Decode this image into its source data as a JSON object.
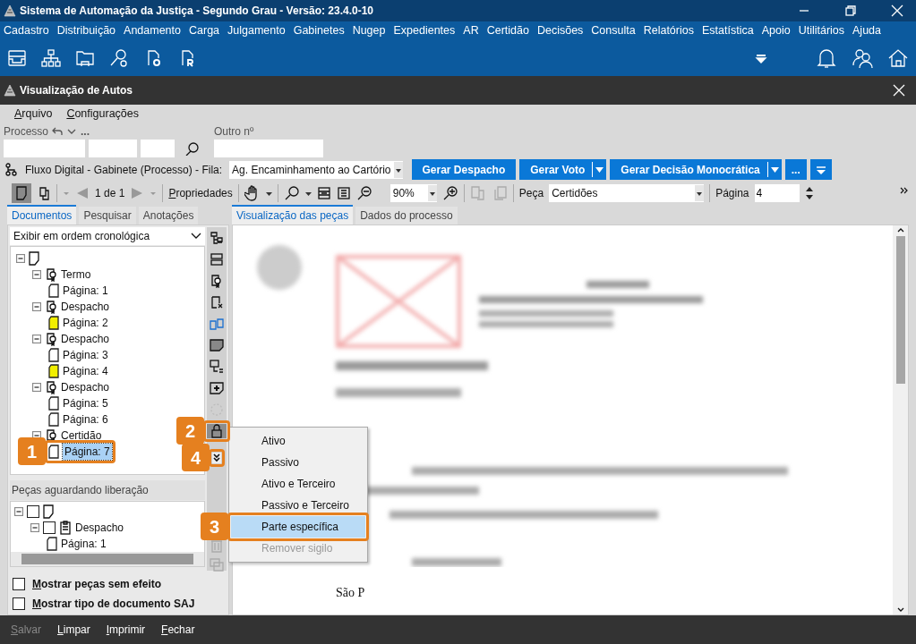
{
  "window": {
    "title": "Sistema de Automação da Justiça - Segundo Grau - Versão: 23.4.0-10"
  },
  "menu": [
    "Cadastro",
    "Distribuição",
    "Andamento",
    "Carga",
    "Julgamento",
    "Gabinetes",
    "Nugep",
    "Expedientes",
    "AR",
    "Certidão",
    "Decisões",
    "Consulta",
    "Relatórios",
    "Estatística",
    "Apoio",
    "Utilitários",
    "Ajuda"
  ],
  "inner_window": {
    "title": "Visualização de Autos"
  },
  "inner_menu": [
    "Arquivo",
    "Configurações"
  ],
  "process": {
    "label": "Processo",
    "more": "...",
    "other_label": "Outro nº"
  },
  "flow": {
    "text": "Fluxo Digital - Gabinete (Processo) - Fila:",
    "queue": "Ag. Encaminhamento ao Cartório"
  },
  "action_buttons": [
    {
      "label": "Gerar Despacho",
      "split": false
    },
    {
      "label": "Gerar Voto",
      "split": true
    },
    {
      "label": "Gerar Decisão Monocrática",
      "split": true
    },
    {
      "label": "...",
      "split": false
    }
  ],
  "toolbar": {
    "pager": "1 de 1",
    "properties": "Propriedades",
    "zoom": "90%",
    "piece_label": "Peça",
    "piece": "Certidões",
    "page_label": "Página",
    "page": "4"
  },
  "left_tabs": [
    {
      "label": "Documentos",
      "selected": true
    },
    {
      "label": "Pesquisar",
      "selected": false
    },
    {
      "label": "Anotações",
      "selected": false
    }
  ],
  "view_tabs": [
    {
      "label": "Visualização das peças",
      "selected": true
    },
    {
      "label": "Dados do processo",
      "selected": false
    }
  ],
  "order": "Exibir em ordem cronológica",
  "tree": {
    "expanded": true,
    "children": [
      {
        "label": "Termo",
        "expanded": true,
        "children": [
          {
            "label": "Página: 1",
            "marked": false,
            "selected": false
          }
        ]
      },
      {
        "label": "Despacho",
        "expanded": true,
        "children": [
          {
            "label": "Página: 2",
            "marked": true,
            "selected": false
          }
        ]
      },
      {
        "label": "Despacho",
        "expanded": true,
        "children": [
          {
            "label": "Página: 3",
            "marked": false,
            "selected": false
          },
          {
            "label": "Página: 4",
            "marked": true,
            "selected": false
          }
        ]
      },
      {
        "label": "Despacho",
        "expanded": true,
        "children": [
          {
            "label": "Página: 5",
            "marked": false,
            "selected": false
          },
          {
            "label": "Página: 6",
            "marked": false,
            "selected": false
          }
        ]
      },
      {
        "label": "Certidão",
        "expanded": true,
        "children": [
          {
            "label": "Página: 7",
            "marked": false,
            "selected": true
          }
        ]
      }
    ]
  },
  "pending": {
    "title": "Peças aguardando liberação",
    "tree": {
      "checked": false,
      "expanded": true,
      "children": [
        {
          "label": "Despacho",
          "checked": false,
          "expanded": true,
          "children": [
            {
              "label": "Página: 1"
            }
          ]
        }
      ]
    }
  },
  "options": [
    {
      "label": "Mostrar peças sem efeito",
      "checked": false
    },
    {
      "label": "Mostrar tipo de documento SAJ",
      "checked": false
    }
  ],
  "context_menu": [
    {
      "label": "Ativo",
      "selected": false,
      "disabled": false
    },
    {
      "label": "Passivo",
      "selected": false,
      "disabled": false
    },
    {
      "label": "Ativo e Terceiro",
      "selected": false,
      "disabled": false
    },
    {
      "label": "Passivo e Terceiro",
      "selected": false,
      "disabled": false
    },
    {
      "label": "Parte específica",
      "selected": true,
      "disabled": false
    },
    {
      "label": "Remover sigilo",
      "selected": false,
      "disabled": true
    }
  ],
  "callouts": [
    "1",
    "2",
    "3",
    "4"
  ],
  "document": {
    "text": "São P"
  },
  "footer": [
    {
      "label": "Salvar",
      "disabled": true
    },
    {
      "label": "Limpar",
      "disabled": false
    },
    {
      "label": "Imprimir",
      "disabled": false
    },
    {
      "label": "Fechar",
      "disabled": false
    }
  ]
}
